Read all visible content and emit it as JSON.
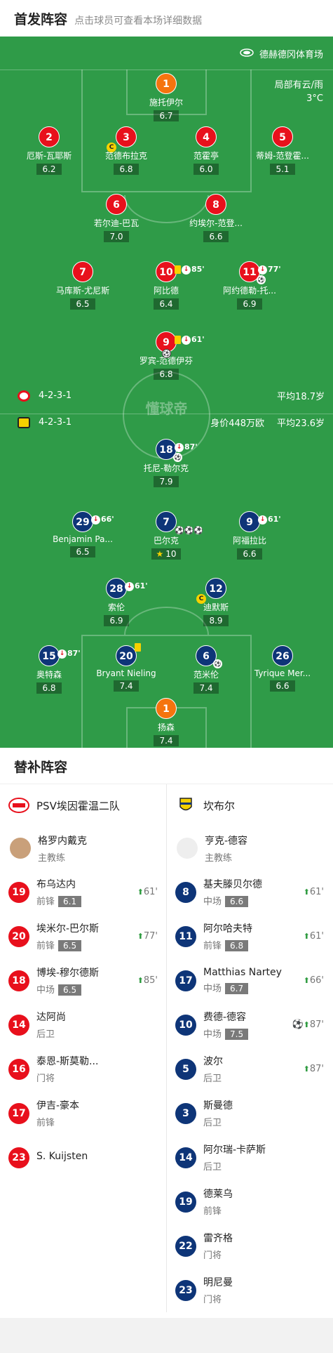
{
  "header": {
    "title": "首发阵容",
    "hint": "点击球员可查看本场详细数据"
  },
  "venue": "德赫德冈体育场",
  "weather": {
    "line1": "局部有云/雨",
    "line2": "3°C"
  },
  "watermark": "懂球帝",
  "home_team": {
    "formation": "4-2-3-1",
    "avg_age": "平均18.7岁",
    "color": "#e8101c"
  },
  "away_team": {
    "formation": "4-2-3-1",
    "value": "身价448万欧",
    "avg_age": "平均23.6岁",
    "color": "#0e3578"
  },
  "home_players": [
    {
      "num": "1",
      "name": "施托伊尔",
      "rating": "6.7"
    },
    {
      "num": "2",
      "name": "厄斯-瓦耶斯",
      "rating": "6.2"
    },
    {
      "num": "3",
      "name": "范德布拉克",
      "rating": "6.8",
      "captain": "C"
    },
    {
      "num": "4",
      "name": "范霍亭",
      "rating": "6.0"
    },
    {
      "num": "5",
      "name": "蒂姆-范登霍...",
      "rating": "5.1"
    },
    {
      "num": "6",
      "name": "若尔迪-巴瓦",
      "rating": "7.0"
    },
    {
      "num": "8",
      "name": "约埃尔-范登...",
      "rating": "6.6"
    },
    {
      "num": "7",
      "name": "马库斯-尤尼斯",
      "rating": "6.5"
    },
    {
      "num": "10",
      "name": "阿比德",
      "rating": "6.4",
      "sub_min": "85'"
    },
    {
      "num": "11",
      "name": "阿约德勒-托...",
      "rating": "6.9",
      "sub_min": "77'"
    },
    {
      "num": "9",
      "name": "罗宾-范德伊芬",
      "rating": "6.8",
      "sub_min": "61'"
    }
  ],
  "away_players": [
    {
      "num": "18",
      "name": "托尼-勒尔克",
      "rating": "7.9",
      "sub_min": "87'"
    },
    {
      "num": "29",
      "name": "Benjamin Pa...",
      "rating": "6.5",
      "sub_min": "66'"
    },
    {
      "num": "7",
      "name": "巴尔克",
      "rating": "10"
    },
    {
      "num": "9",
      "name": "阿福拉比",
      "rating": "6.6",
      "sub_min": "61'"
    },
    {
      "num": "28",
      "name": "索伦",
      "rating": "6.9",
      "sub_min": "61'"
    },
    {
      "num": "12",
      "name": "迪默斯",
      "rating": "8.9",
      "captain": "C"
    },
    {
      "num": "15",
      "name": "奥特森",
      "rating": "6.8",
      "sub_min": "87'"
    },
    {
      "num": "20",
      "name": "Bryant Nieling",
      "rating": "7.4"
    },
    {
      "num": "6",
      "name": "范米伦",
      "rating": "7.4"
    },
    {
      "num": "26",
      "name": "Tyrique Mer...",
      "rating": "6.6"
    },
    {
      "num": "1",
      "name": "扬森",
      "rating": "7.4"
    }
  ],
  "subs": {
    "title": "替补阵容",
    "home": {
      "team": "PSV埃因霍温二队",
      "coach": {
        "name": "格罗内戴克",
        "role": "主教练"
      },
      "players": [
        {
          "num": "19",
          "name": "布乌达内",
          "pos": "前锋",
          "rating": "6.1",
          "min": "61'"
        },
        {
          "num": "20",
          "name": "埃米尔-巴尔斯",
          "pos": "前锋",
          "rating": "6.5",
          "min": "77'"
        },
        {
          "num": "18",
          "name": "博埃-穆尔德斯",
          "pos": "中场",
          "rating": "6.5",
          "min": "85'"
        },
        {
          "num": "14",
          "name": "达阿尚",
          "pos": "后卫"
        },
        {
          "num": "16",
          "name": "泰恩-斯莫勒...",
          "pos": "门将"
        },
        {
          "num": "17",
          "name": "伊吉-豪本",
          "pos": "前锋"
        },
        {
          "num": "23",
          "name": "S. Kuijsten",
          "pos": ""
        }
      ]
    },
    "away": {
      "team": "坎布尔",
      "coach": {
        "name": "亨克-德容",
        "role": "主教练"
      },
      "players": [
        {
          "num": "8",
          "name": "基夫滕贝尔德",
          "pos": "中场",
          "rating": "6.6",
          "min": "61'"
        },
        {
          "num": "11",
          "name": "阿尔哈夫特",
          "pos": "前锋",
          "rating": "6.8",
          "min": "61'"
        },
        {
          "num": "17",
          "name": "Matthias Nartey",
          "pos": "中场",
          "rating": "6.7",
          "min": "66'"
        },
        {
          "num": "10",
          "name": "费德-德容",
          "pos": "中场",
          "rating": "7.5",
          "min": "87'",
          "goal": true
        },
        {
          "num": "5",
          "name": "波尔",
          "pos": "后卫",
          "min": "87'"
        },
        {
          "num": "3",
          "name": "斯曼德",
          "pos": "后卫"
        },
        {
          "num": "14",
          "name": "阿尔瑞-卡萨斯",
          "pos": "后卫"
        },
        {
          "num": "19",
          "name": "德莱乌",
          "pos": "前锋"
        },
        {
          "num": "22",
          "name": "雷齐格",
          "pos": "门将"
        },
        {
          "num": "23",
          "name": "明尼曼",
          "pos": "门将"
        }
      ]
    }
  }
}
